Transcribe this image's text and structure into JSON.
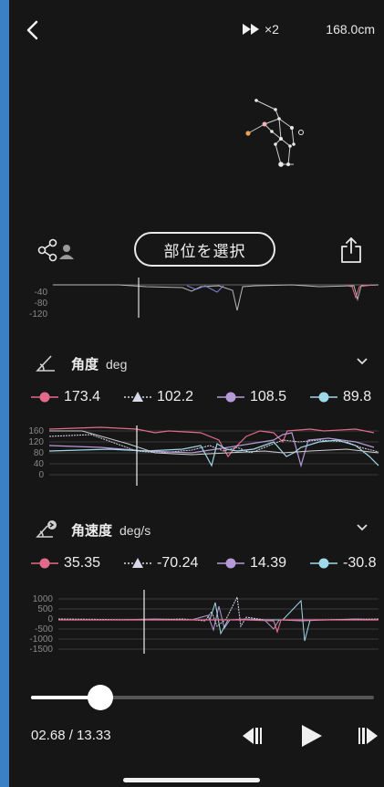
{
  "header": {
    "speed_label": "×2",
    "height_label": "168.0cm"
  },
  "toolbar": {
    "select_part_label": "部位を選択"
  },
  "top_chart": {
    "y_ticks": [
      "-40",
      "-80",
      "-120"
    ]
  },
  "angle_section": {
    "title": "角度",
    "unit": "deg",
    "legend": [
      {
        "marker": "circle",
        "color": "#e36a8a",
        "value": "173.4"
      },
      {
        "marker": "triangle",
        "color": "#d8d8e8",
        "value": "102.2"
      },
      {
        "marker": "circle",
        "color": "#b69ad8",
        "value": "108.5"
      },
      {
        "marker": "circle",
        "color": "#9fd8e8",
        "value": "89.8"
      }
    ],
    "y_ticks": [
      "160",
      "120",
      "80",
      "40",
      "0"
    ]
  },
  "angular_velocity_section": {
    "title": "角速度",
    "unit": "deg/s",
    "legend": [
      {
        "marker": "circle",
        "color": "#e36a8a",
        "value": "35.35"
      },
      {
        "marker": "triangle",
        "color": "#d8d8e8",
        "value": "-70.24"
      },
      {
        "marker": "circle",
        "color": "#b69ad8",
        "value": "14.39"
      },
      {
        "marker": "circle",
        "color": "#9fd8e8",
        "value": "-30.8"
      }
    ],
    "y_ticks": [
      "1000",
      "500",
      "0",
      "-500",
      "-1000",
      "-1500"
    ]
  },
  "playback": {
    "time_label": "02.68 / 13.33",
    "progress": 0.201
  },
  "colors": {
    "red": "#e36a8a",
    "white_dotted": "#d8d8e8",
    "purple": "#b69ad8",
    "cyan": "#9fd8e8",
    "orange_joint": "#f0a050"
  },
  "icons": {
    "back": "chevron-left-icon",
    "speed": "fast-forward-icon",
    "share": "share-users-icon",
    "export": "export-icon",
    "angle": "angle-icon",
    "velocity": "angular-velocity-icon",
    "prev": "step-back-icon",
    "play": "play-icon",
    "next": "step-forward-icon"
  }
}
